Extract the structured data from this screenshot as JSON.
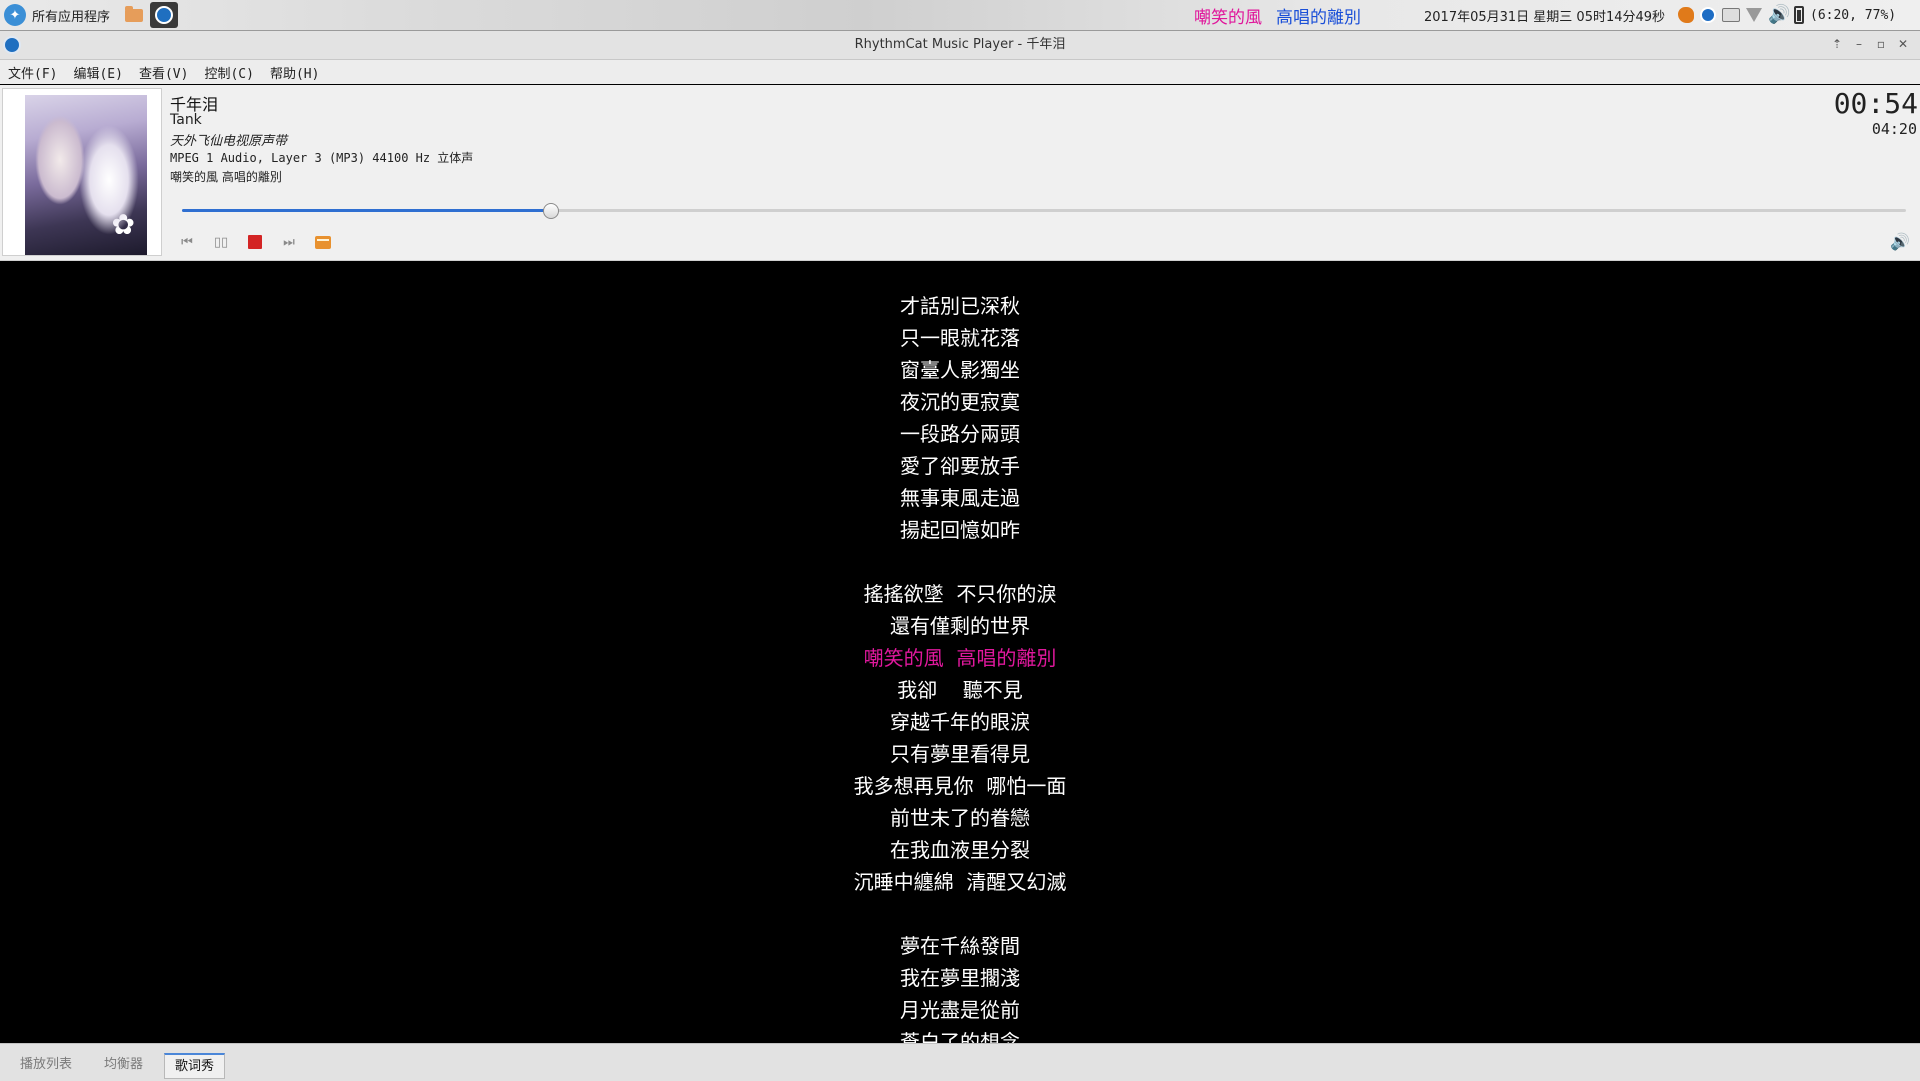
{
  "taskbar": {
    "start_label": "所有应用程序",
    "lyric_sung": "嘲笑的風",
    "lyric_unsung": "高唱的離別",
    "clock": "2017年05月31日 星期三 05时14分49秒",
    "battery_text": "(6:20, 77%)"
  },
  "window": {
    "title": "RhythmCat Music Player - 千年泪",
    "menus": [
      "文件(F)",
      "编辑(E)",
      "查看(V)",
      "控制(C)",
      "帮助(H)"
    ]
  },
  "track": {
    "title": "千年泪",
    "artist": "Tank",
    "album": "天外飞仙电视原声带",
    "format": "MPEG 1 Audio, Layer 3 (MP3) 44100 Hz 立体声",
    "current_lyric": "嘲笑的風 高唱的離別",
    "elapsed": "00:54",
    "total": "04:20",
    "progress": 0.214
  },
  "lyrics": {
    "lines": [
      "才話別已深秋",
      "只一眼就花落",
      "窗臺人影獨坐",
      "夜沉的更寂寞",
      "一段路分兩頭",
      "愛了卻要放手",
      "無事東風走過",
      "揚起回憶如昨",
      "",
      "搖搖欲墜  不只你的淚",
      "還有僅剩的世界",
      "嘲笑的風  高唱的離別",
      "我卻    聽不見",
      "穿越千年的眼淚",
      "只有夢里看得見",
      "我多想再見你  哪怕一面",
      "前世未了的眷戀",
      "在我血液里分裂",
      "沉睡中纏綿  清醒又幻滅",
      "",
      "夢在千絲發間",
      "我在夢里擱淺",
      "月光盡是從前",
      "蒼白了的想念"
    ],
    "current_index": 11
  },
  "tabs": {
    "playlist": "播放列表",
    "equalizer": "均衡器",
    "lyric_show": "歌词秀"
  },
  "colors": {
    "lyric_highlight": "#e0189d",
    "lyric_normal": "#ffffff",
    "seek_fill": "#2f6fd1"
  }
}
